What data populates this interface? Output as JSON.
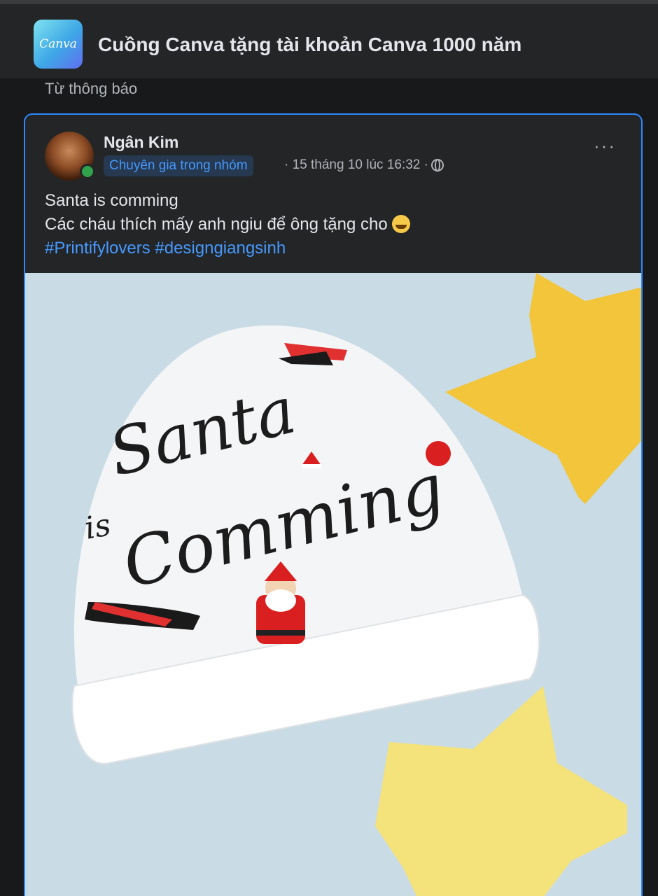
{
  "group": {
    "logo_text": "Canva",
    "title": "Cuồng Canva tặng tài khoản Canva 1000 năm",
    "from_label": "Từ thông báo"
  },
  "post": {
    "author": "Ngân Kim",
    "badge": "Chuyên gia trong nhóm",
    "timestamp": "· 15 tháng 10 lúc 16:32 ·",
    "more_label": "···",
    "line1": "Santa is comming",
    "line2": "Các cháu thích mấy anh ngiu để ông tặng cho",
    "hashtags": "#Printifylovers #designgiangsinh",
    "image": {
      "text_line1": "Santa",
      "text_line2": "is",
      "text_line3": "Comming"
    }
  },
  "colors": {
    "accent": "#2d88ff",
    "link": "#4599ff",
    "online": "#31a24c",
    "background": "#18191a",
    "card": "#242526"
  },
  "icons": [
    "canva-logo-icon",
    "globe-icon",
    "more-icon",
    "grinning-emoji-icon",
    "online-status-icon"
  ]
}
